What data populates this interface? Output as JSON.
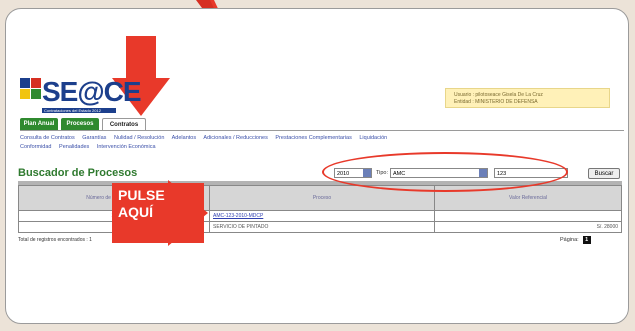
{
  "brand": {
    "logo_text": "SE@CE",
    "tagline": "Contrataciones del Estado 2012"
  },
  "user_info": {
    "line1": "Usuario : pilotoseace Gisela De La Cruz",
    "line2": "Entidad : MINISTERIO DE DEFENSA"
  },
  "tabs": [
    {
      "label": "Plan Anual"
    },
    {
      "label": "Procesos"
    },
    {
      "label": "Contratos"
    }
  ],
  "menu": [
    "Consulta de Contratos",
    "Garantías",
    "Nulidad / Resolución",
    "Adelantos",
    "Adicionales / Reducciones",
    "Prestaciones Complementarias",
    "Liquidación",
    "Conformidad",
    "Penalidades",
    "Intervención Económica"
  ],
  "search": {
    "title": "Buscador de Procesos",
    "year": "2010",
    "tipo_label": "Tipo:",
    "tipo_value": "AMC",
    "number_value": "123",
    "button": "Buscar"
  },
  "table": {
    "headers": [
      "Número de Convocatoria",
      "Proceso",
      "Valor Referencial"
    ],
    "rows": [
      {
        "num": "1x",
        "proceso": "AMC-123-2010-MDCP",
        "valor": ""
      },
      {
        "num": "",
        "proceso": "SERVICIO DE PINTADO",
        "valor": "S/. 28000"
      }
    ]
  },
  "footer": {
    "total": "Total de registros encontrados : 1",
    "page_label": "Página:",
    "page_num": "1"
  },
  "callout": {
    "line1": "PULSE",
    "line2": "AQUÍ"
  },
  "colors": {
    "annotation_red": "#e8392a",
    "tab_green": "#2f8a2f",
    "title_green": "#2f7a2f",
    "logo_blue": "#1c3f8c"
  }
}
